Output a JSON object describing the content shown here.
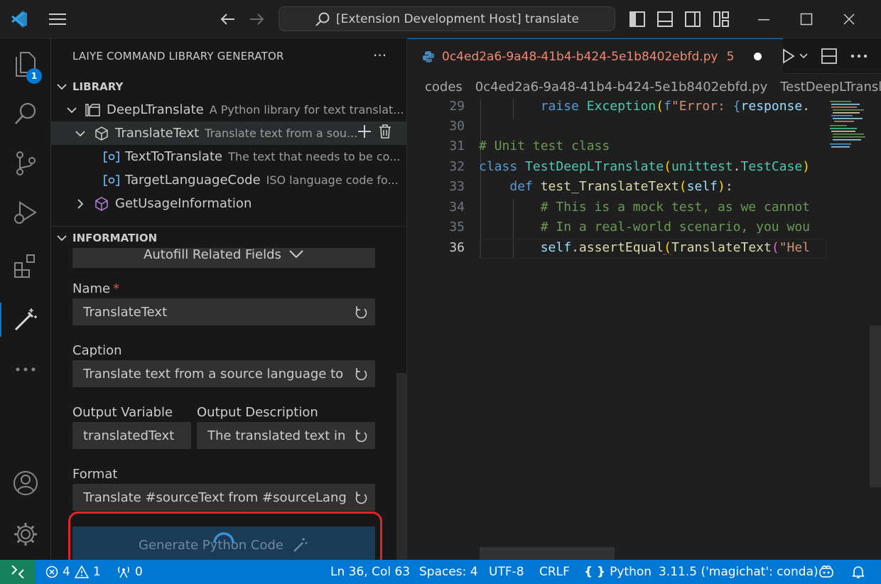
{
  "titlebar": {
    "search_text": "[Extension Development Host] translate"
  },
  "activity": {
    "explorer_badge": "1"
  },
  "sidebar": {
    "title": "LAIYE COMMAND LIBRARY GENERATOR",
    "more": "···",
    "library_header": "LIBRARY",
    "tree": [
      {
        "label": "DeepLTranslate",
        "desc": "A Python library for text translat..."
      },
      {
        "label": "TranslateText",
        "desc": "Translate text from a sou..."
      },
      {
        "label": "TextToTranslate",
        "desc": "The text that needs to be co..."
      },
      {
        "label": "TargetLanguageCode",
        "desc": "ISO language code fo..."
      },
      {
        "label": "GetUsageInformation",
        "desc": ""
      }
    ],
    "information_header": "INFORMATION"
  },
  "form": {
    "autofill_label": "Autofill Related Fields",
    "name_label": "Name",
    "name_required": "*",
    "name_value": "TranslateText",
    "caption_label": "Caption",
    "caption_value": "Translate text from a source language to a",
    "output_variable_label": "Output Variable",
    "output_variable_value": "translatedText",
    "output_description_label": "Output Description",
    "output_description_value": "The translated text in",
    "format_label": "Format",
    "format_value": "Translate #sourceText from #sourceLang to",
    "generate_button": "Generate Python Code"
  },
  "editor": {
    "tab_filename": "0c4ed2a6-9a48-41b4-b424-5e1b8402ebfd.py",
    "tab_problems": "5",
    "breadcrumb": [
      "codes",
      "0c4ed2a6-9a48-41b4-b424-5e1b8402ebfd.py",
      "TestDeepLTranslate"
    ],
    "line_numbers": [
      "29",
      "30",
      "31",
      "32",
      "33",
      "34",
      "35",
      "36"
    ]
  },
  "statusbar": {
    "errors": "4",
    "warnings": "1",
    "ports": "0",
    "position": "Ln 36, Col 63",
    "spaces": "Spaces: 4",
    "encoding": "UTF-8",
    "eol": "CRLF",
    "language": "Python",
    "interpreter": "3.11.5 ('magichat': conda)"
  },
  "colors": {
    "accent": "#0078d4",
    "error": "#f48771",
    "highlight_box": "#e0242c"
  }
}
